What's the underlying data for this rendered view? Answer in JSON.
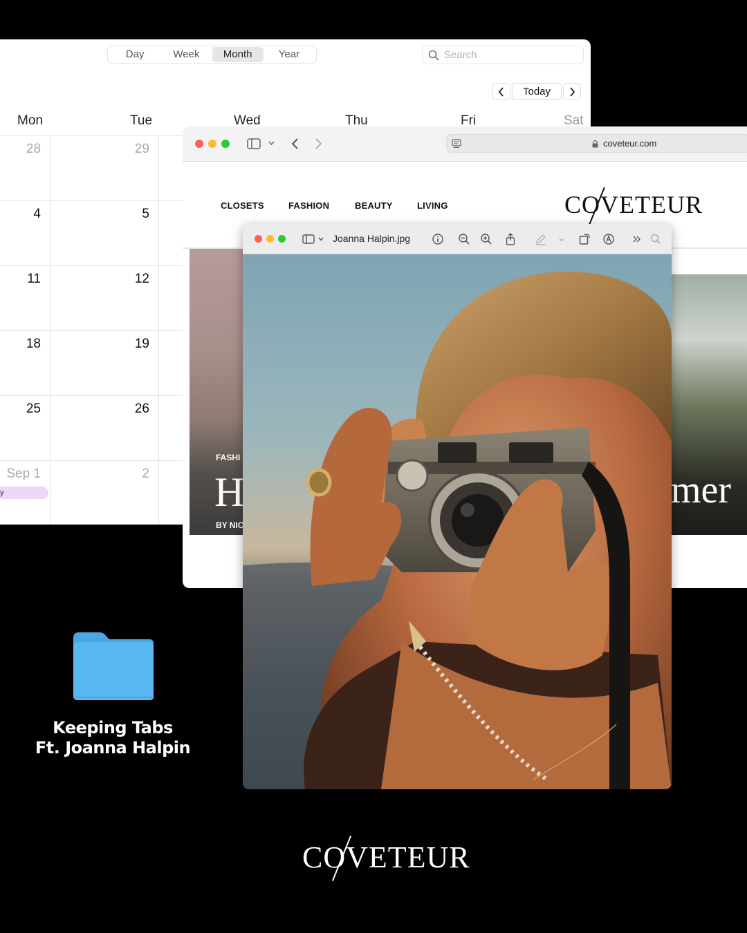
{
  "calendar": {
    "view_options": [
      "Day",
      "Week",
      "Month",
      "Year"
    ],
    "active_view": "Month",
    "search_placeholder": "Search",
    "today_label": "Today",
    "weekdays": [
      "Mon",
      "Tue",
      "Wed",
      "Thu",
      "Fri",
      "Sat"
    ],
    "weeks": [
      [
        "28",
        "29"
      ],
      [
        "4",
        "5"
      ],
      [
        "11",
        "12"
      ],
      [
        "18",
        "19"
      ],
      [
        "25",
        "26"
      ],
      [
        "Sep 1",
        "2"
      ]
    ],
    "event_fragment": "y"
  },
  "browser": {
    "url": "coveteur.com",
    "nav": [
      "CLOSETS",
      "FASHION",
      "BEAUTY",
      "LIVING"
    ],
    "logo": "COVETEUR",
    "card_left": {
      "tag": "FASHI",
      "headline": "H",
      "byline": "BY NIC"
    },
    "card_right": {
      "headline": "mer"
    }
  },
  "preview": {
    "filename": "Joanna Halpin.jpg"
  },
  "folder": {
    "line1": "Keeping Tabs",
    "line2": "Ft. Joanna Halpin"
  },
  "footer_logo": "COVETEUR",
  "colors": {
    "background": "#000000",
    "folder": "#5ab8f0",
    "close": "#fe5f57",
    "minimize": "#febc2e",
    "zoom": "#28c840",
    "event": "#ecd8f6"
  }
}
